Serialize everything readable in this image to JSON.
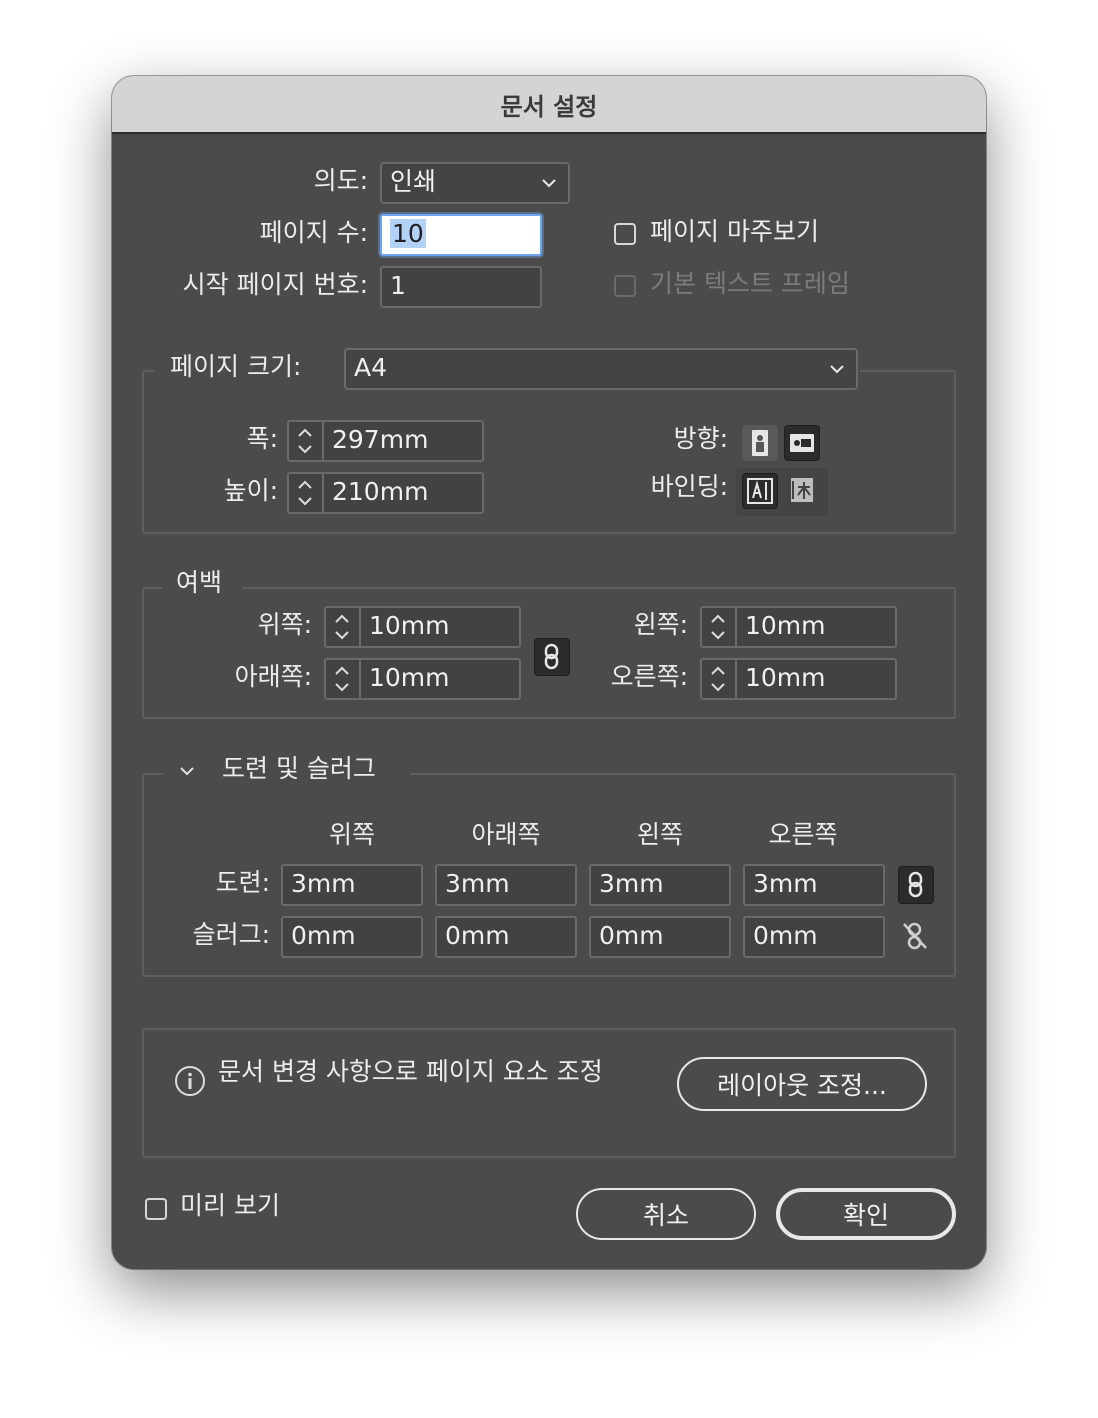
{
  "window": {
    "title": "문서 설정"
  },
  "top": {
    "intent_label": "의도:",
    "intent_value": "인쇄",
    "page_count_label": "페이지 수:",
    "page_count_value": "10",
    "start_page_label": "시작 페이지 번호:",
    "start_page_value": "1",
    "facing_pages_label": "페이지 마주보기",
    "primary_text_frame_label": "기본 텍스트 프레임"
  },
  "page_size": {
    "label": "페이지 크기:",
    "value": "A4",
    "width_label": "폭:",
    "width_value": "297mm",
    "height_label": "높이:",
    "height_value": "210mm",
    "orientation_label": "방향:",
    "binding_label": "바인딩:"
  },
  "margins": {
    "label": "여백",
    "top_label": "위쪽:",
    "top_value": "10mm",
    "bottom_label": "아래쪽:",
    "bottom_value": "10mm",
    "left_label": "왼쪽:",
    "left_value": "10mm",
    "right_label": "오른쪽:",
    "right_value": "10mm"
  },
  "bleed_slug": {
    "label": "도련 및 슬러그",
    "columns": [
      "위쪽",
      "아래쪽",
      "왼쪽",
      "오른쪽"
    ],
    "bleed_label": "도련:",
    "bleed_values": [
      "3mm",
      "3mm",
      "3mm",
      "3mm"
    ],
    "slug_label": "슬러그:",
    "slug_values": [
      "0mm",
      "0mm",
      "0mm",
      "0mm"
    ]
  },
  "adjust": {
    "info_text": "문서 변경 사항으로 페이지 요소 조정",
    "button_label": "레이아웃 조정..."
  },
  "footer": {
    "preview_label": "미리 보기",
    "cancel_label": "취소",
    "ok_label": "확인"
  }
}
